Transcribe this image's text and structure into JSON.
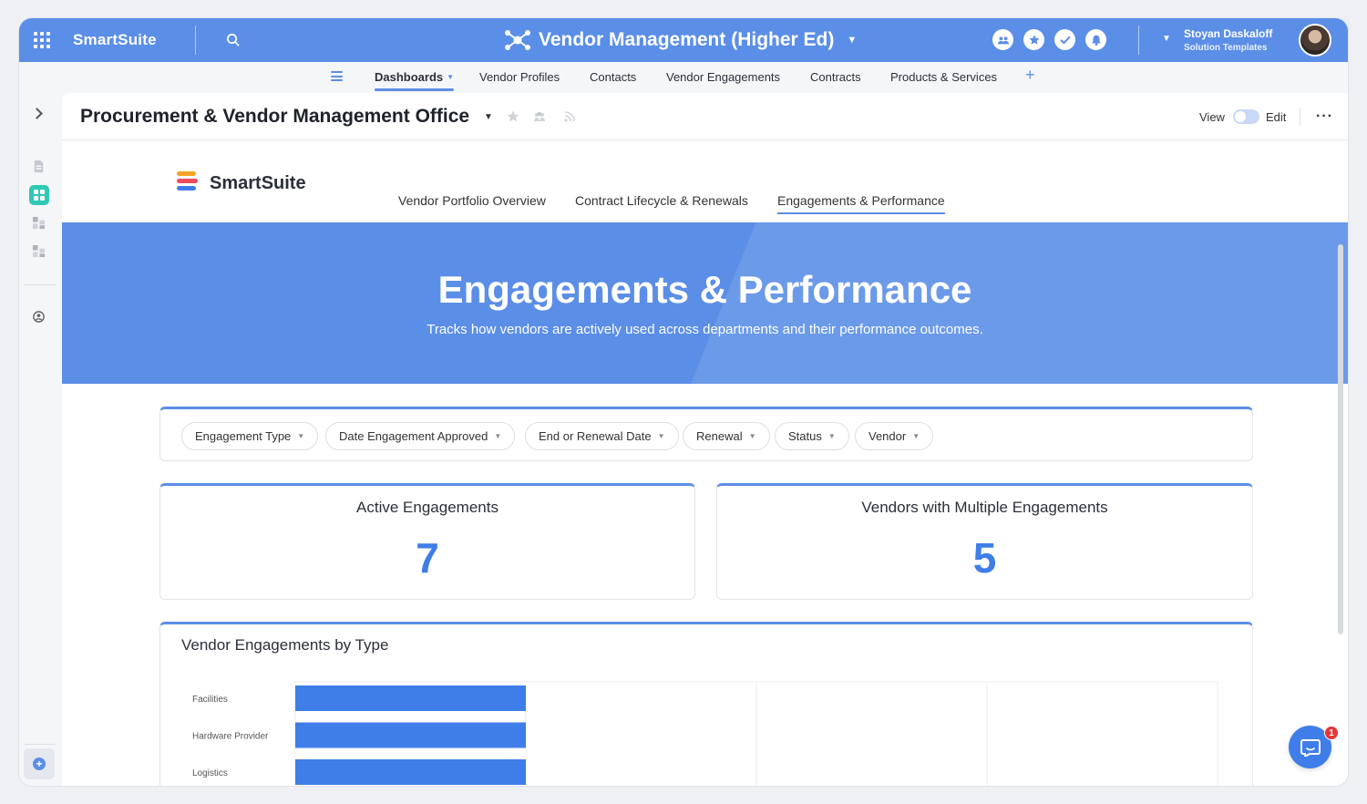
{
  "app": {
    "brand": "SmartSuite",
    "solution_title": "Vendor Management (Higher Ed)",
    "user_name": "Stoyan Daskaloff",
    "user_role": "Solution Templates"
  },
  "nav": {
    "tabs": [
      {
        "label": "Dashboards",
        "active": true
      },
      {
        "label": "Vendor Profiles"
      },
      {
        "label": "Contacts"
      },
      {
        "label": "Vendor Engagements"
      },
      {
        "label": "Contracts"
      },
      {
        "label": "Products & Services"
      }
    ],
    "add_label": "+"
  },
  "page": {
    "title": "Procurement & Vendor Management Office",
    "view_label": "View",
    "edit_label": "Edit",
    "more_label": "···"
  },
  "dashboard": {
    "logo_text": "SmartSuite",
    "tabs": [
      {
        "label": "Vendor Portfolio Overview"
      },
      {
        "label": "Contract Lifecycle & Renewals"
      },
      {
        "label": "Engagements & Performance",
        "active": true
      }
    ],
    "hero_title": "Engagements & Performance",
    "hero_subtitle": "Tracks how vendors are actively used across departments and their performance outcomes.",
    "filters": [
      "Engagement Type",
      "Date Engagement Approved",
      "End or Renewal Date",
      "Renewal",
      "Status",
      "Vendor"
    ],
    "kpis": [
      {
        "label": "Active Engagements",
        "value": "7"
      },
      {
        "label": "Vendors with Multiple Engagements",
        "value": "5"
      }
    ]
  },
  "chart_data": {
    "type": "bar",
    "orientation": "horizontal",
    "title": "Vendor Engagements by Type",
    "categories": [
      "Facilities",
      "Hardware Provider",
      "Logistics"
    ],
    "values": [
      1,
      1,
      1
    ],
    "xlim": [
      0,
      4
    ],
    "grid": true,
    "bar_color": "#3f7ee8"
  },
  "colors": {
    "accent": "#5b8ee6",
    "kpi": "#3f7ee8",
    "active_rail": "#2fc9b4",
    "notification": "#e4353c"
  },
  "chat": {
    "badge_count": "1"
  }
}
